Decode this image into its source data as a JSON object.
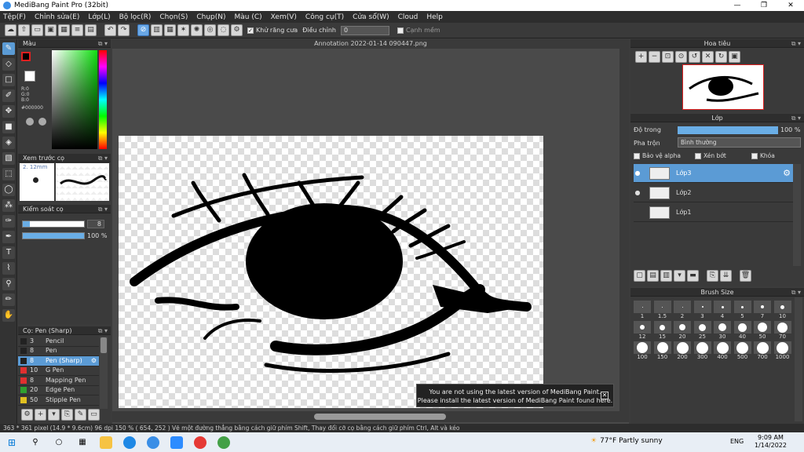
{
  "window": {
    "title": "MediBang Paint Pro (32bit)",
    "minimize": "—",
    "maximize": "❐",
    "close": "✕"
  },
  "menu": [
    "Tệp(F)",
    "Chỉnh sửa(E)",
    "Lớp(L)",
    "Bộ lọc(R)",
    "Chọn(S)",
    "Chụp(N)",
    "Màu (C)",
    "Xem(V)",
    "Công cụ(T)",
    "Cửa sổ(W)",
    "Cloud",
    "Help"
  ],
  "toolbar": {
    "antialias_label": "Khử răng cưa",
    "correction_label": "Điều chỉnh",
    "correction_value": "0",
    "snap_label": "Cạnh mềm"
  },
  "color_panel": {
    "title": "Màu",
    "r": "R:0",
    "g": "G:0",
    "b": "B:0",
    "hex": "#000000"
  },
  "preview_panel": {
    "title": "Xem trước cọ",
    "size": "2. 12mm"
  },
  "brush_control": {
    "title": "Kiểm soát cọ",
    "size_value": "8",
    "opacity_value": "100 %"
  },
  "brush_list": {
    "title": "Cọ: Pen (Sharp)",
    "items": [
      {
        "size": "3",
        "name": "Pencil",
        "color": "#222222"
      },
      {
        "size": "8",
        "name": "Pen",
        "color": "#222222"
      },
      {
        "size": "8",
        "name": "Pen (Sharp)",
        "color": "#222222"
      },
      {
        "size": "10",
        "name": "G Pen",
        "color": "#e03030"
      },
      {
        "size": "8",
        "name": "Mapping Pen",
        "color": "#e03030"
      },
      {
        "size": "20",
        "name": "Edge Pen",
        "color": "#30a030"
      },
      {
        "size": "50",
        "name": "Stipple Pen",
        "color": "#e0c020"
      }
    ]
  },
  "document": {
    "title": "Annotation 2022-01-14 090447.png"
  },
  "toast": {
    "line1": "You are not using the latest version of MediBang Paint.",
    "line2": "Please install the latest version of MediBang Paint found here.",
    "close": "✕"
  },
  "navigator": {
    "title": "Hoa tiêu"
  },
  "layers": {
    "title": "Lớp",
    "opacity_label": "Độ trong",
    "opacity_value": "100 %",
    "opacity_level": 1.0,
    "blend_label": "Pha trộn",
    "blend_value": "Bình thường",
    "protect_alpha": "Bảo vệ alpha",
    "clipping": "Xén bớt",
    "lock": "Khóa",
    "items": [
      {
        "name": "Lớp3",
        "selected": true
      },
      {
        "name": "Lớp2",
        "selected": false
      },
      {
        "name": "Lớp1",
        "selected": false
      }
    ]
  },
  "brush_size": {
    "title": "Brush Size",
    "rows": [
      [
        "1",
        "1.5",
        "2",
        "3",
        "4",
        "5",
        "7",
        "10"
      ],
      [
        "12",
        "15",
        "20",
        "25",
        "30",
        "40",
        "50",
        "70"
      ],
      [
        "100",
        "150",
        "200",
        "300",
        "400",
        "500",
        "700",
        "1000"
      ]
    ]
  },
  "status": {
    "text": "363 * 361 pixel   (14.9 * 9.6cm)   96 dpi   150 %   ( 654, 252 )   Vẽ một đường thẳng bằng cách giữ phím Shift, Thay đổi cỡ cọ bằng cách giữ phím Ctrl, Alt và kéo"
  },
  "taskbar": {
    "weather": "77°F  Partly sunny",
    "lang": "ENG",
    "time": "9:09 AM",
    "date": "1/14/2022"
  }
}
